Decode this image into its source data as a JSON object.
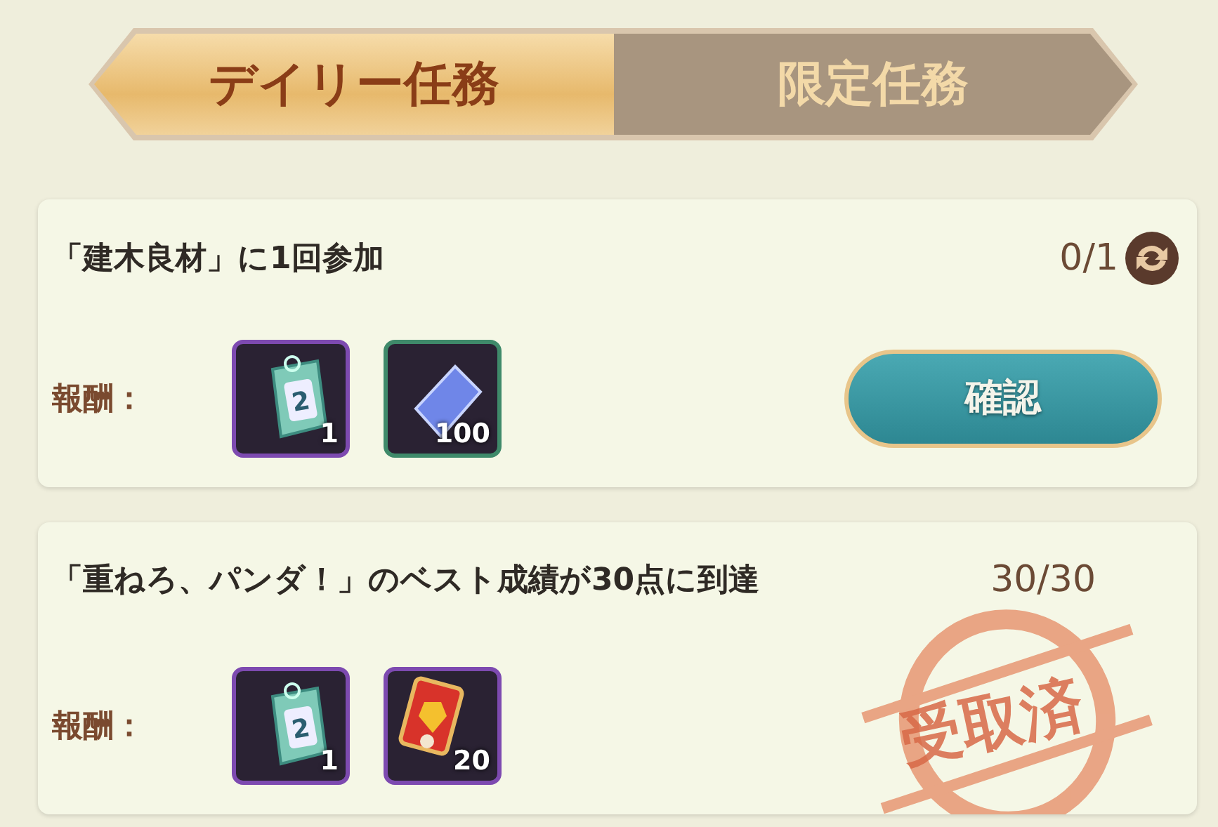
{
  "tabs": [
    {
      "label": "デイリー任務",
      "selected": true
    },
    {
      "label": "限定任務",
      "selected": false
    }
  ],
  "tasks": [
    {
      "title": "「建木良材」に1回参加",
      "progress": "0/1",
      "refresh": true,
      "reward_label": "報酬：",
      "rewards": [
        {
          "kind": "ticket",
          "badge": "2",
          "count": "1",
          "color": "#7d4ab0"
        },
        {
          "kind": "crystal",
          "count": "100",
          "color": "#3f8a6a"
        }
      ],
      "action": {
        "kind": "button",
        "label": "確認"
      }
    },
    {
      "title": "「重ねろ、パンダ！」のベスト成績が30点に到達",
      "progress": "30/30",
      "refresh": false,
      "reward_label": "報酬：",
      "rewards": [
        {
          "kind": "ticket",
          "badge": "2",
          "count": "1",
          "color": "#7d4ab0"
        },
        {
          "kind": "card",
          "count": "20",
          "color": "#7d4ab0"
        }
      ],
      "action": {
        "kind": "stamp",
        "label": "受取済"
      }
    }
  ]
}
